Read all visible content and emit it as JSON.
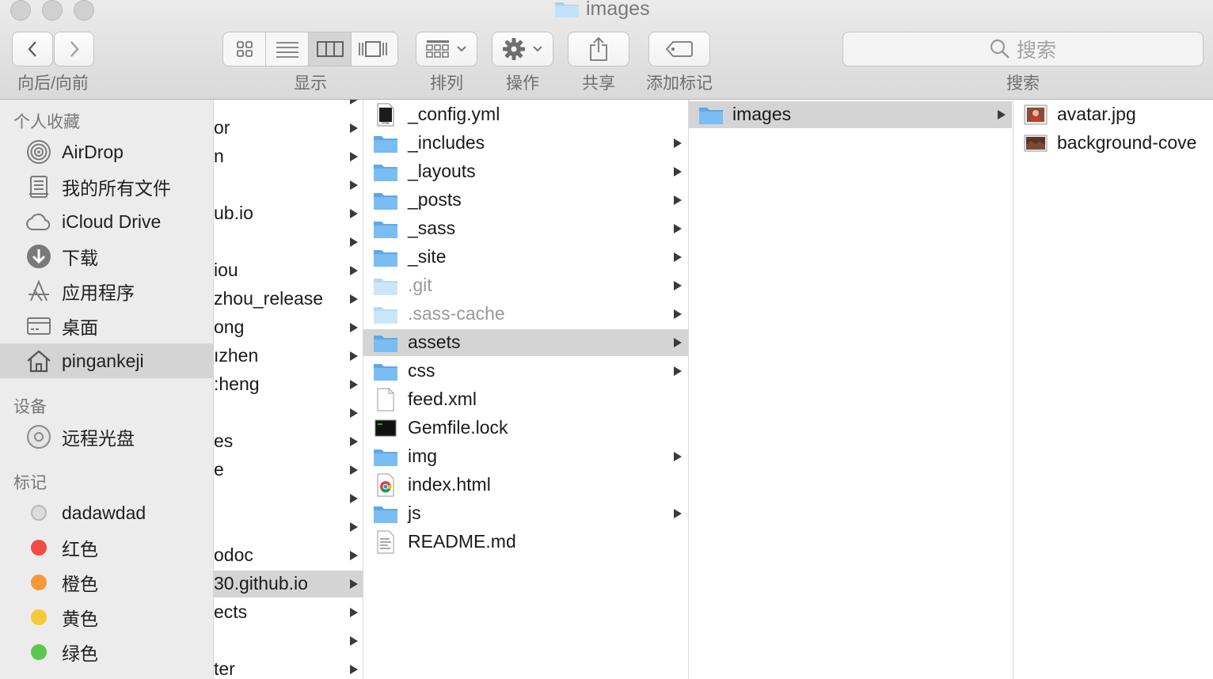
{
  "window": {
    "title": "images"
  },
  "toolbar": {
    "nav_label": "向后/向前",
    "view_label": "显示",
    "arrange_label": "排列",
    "action_label": "操作",
    "share_label": "共享",
    "tags_label": "添加标记",
    "search_label": "搜索",
    "search_placeholder": "搜索",
    "active_view": "columns"
  },
  "sidebar": {
    "favorites_header": "个人收藏",
    "favorites": [
      {
        "label": "AirDrop",
        "icon": "airdrop-icon"
      },
      {
        "label": "我的所有文件",
        "icon": "all-files-icon"
      },
      {
        "label": "iCloud Drive",
        "icon": "cloud-icon"
      },
      {
        "label": "下载",
        "icon": "download-icon"
      },
      {
        "label": "应用程序",
        "icon": "applications-icon"
      },
      {
        "label": "桌面",
        "icon": "desktop-icon"
      },
      {
        "label": "pingankeji",
        "icon": "home-icon",
        "selected": true
      }
    ],
    "devices_header": "设备",
    "devices": [
      {
        "label": "远程光盘",
        "icon": "disc-icon"
      }
    ],
    "tags_header": "标记",
    "tags": [
      {
        "label": "dadawdad",
        "color": "#d0d0d0"
      },
      {
        "label": "红色",
        "color": "#f24b42"
      },
      {
        "label": "橙色",
        "color": "#f7973a"
      },
      {
        "label": "黄色",
        "color": "#f6c834"
      },
      {
        "label": "绿色",
        "color": "#5ac94b"
      }
    ]
  },
  "column1": {
    "items": [
      {
        "label": "",
        "arrow": true
      },
      {
        "label": "or",
        "arrow": true
      },
      {
        "label": "n",
        "arrow": true
      },
      {
        "label": "",
        "arrow": true
      },
      {
        "label": "ub.io",
        "arrow": true
      },
      {
        "label": "",
        "arrow": true
      },
      {
        "label": "iou",
        "arrow": true
      },
      {
        "label": "zhou_release",
        "arrow": true
      },
      {
        "label": "ong",
        "arrow": true
      },
      {
        "label": "ızhen",
        "arrow": true
      },
      {
        "label": ":heng",
        "arrow": true
      },
      {
        "label": "",
        "arrow": true
      },
      {
        "label": "es",
        "arrow": true
      },
      {
        "label": "e",
        "arrow": true
      },
      {
        "label": "",
        "arrow": true
      },
      {
        "label": "",
        "arrow": true
      },
      {
        "label": "odoc",
        "arrow": true
      },
      {
        "label": "30.github.io",
        "arrow": true,
        "selected": true
      },
      {
        "label": "ects",
        "arrow": true
      },
      {
        "label": "",
        "arrow": true
      },
      {
        "label": "ter",
        "arrow": true
      }
    ]
  },
  "column2": {
    "items": [
      {
        "label": "_config.yml",
        "icon": "yaml-file-icon",
        "arrow": false
      },
      {
        "label": "_includes",
        "icon": "folder-icon",
        "arrow": true
      },
      {
        "label": "_layouts",
        "icon": "folder-icon",
        "arrow": true
      },
      {
        "label": "_posts",
        "icon": "folder-icon",
        "arrow": true
      },
      {
        "label": "_sass",
        "icon": "folder-icon",
        "arrow": true
      },
      {
        "label": "_site",
        "icon": "folder-icon",
        "arrow": true
      },
      {
        "label": ".git",
        "icon": "hidden-folder-icon",
        "arrow": true,
        "dim": true
      },
      {
        "label": ".sass-cache",
        "icon": "hidden-folder-icon",
        "arrow": true,
        "dim": true
      },
      {
        "label": "assets",
        "icon": "folder-icon",
        "arrow": true,
        "selected": true
      },
      {
        "label": "css",
        "icon": "folder-icon",
        "arrow": true
      },
      {
        "label": "feed.xml",
        "icon": "blank-file-icon",
        "arrow": false
      },
      {
        "label": "Gemfile.lock",
        "icon": "terminal-file-icon",
        "arrow": false
      },
      {
        "label": "img",
        "icon": "folder-icon",
        "arrow": true
      },
      {
        "label": "index.html",
        "icon": "chrome-file-icon",
        "arrow": false
      },
      {
        "label": "js",
        "icon": "folder-icon",
        "arrow": true
      },
      {
        "label": "README.md",
        "icon": "text-file-icon",
        "arrow": false
      }
    ]
  },
  "column3": {
    "items": [
      {
        "label": "images",
        "icon": "folder-icon",
        "arrow": true,
        "selected": true
      }
    ]
  },
  "column4": {
    "items": [
      {
        "label": "avatar.jpg",
        "icon": "image-thumbnail-icon"
      },
      {
        "label": "background-cove",
        "icon": "image-thumbnail-icon"
      }
    ]
  }
}
